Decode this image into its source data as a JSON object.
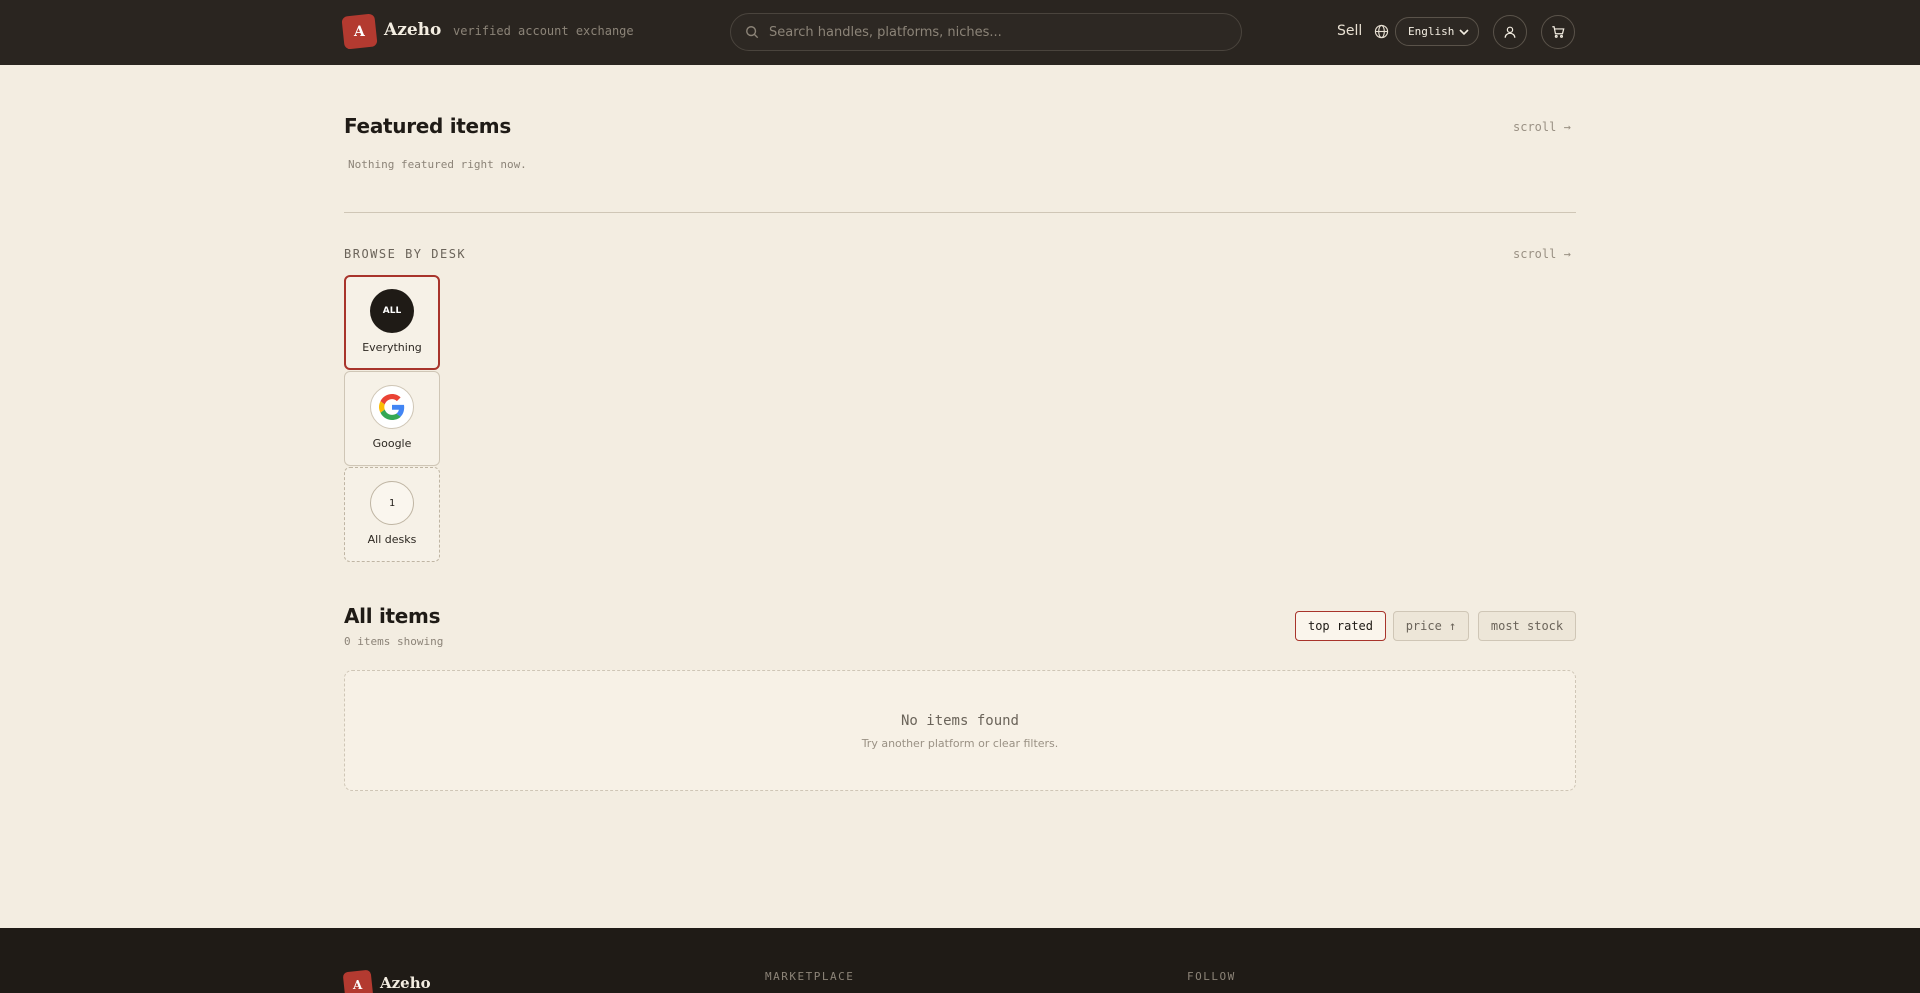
{
  "header": {
    "logo_letter": "A",
    "brand": "Azeho",
    "tagline": "verified account exchange",
    "search_placeholder": "Search handles, platforms, niches...",
    "sell_label": "Sell",
    "language": "English"
  },
  "featured": {
    "title": "Featured items",
    "scroll_label": "scroll →",
    "empty_text": "Nothing featured right now."
  },
  "browse": {
    "kicker": "BROWSE BY DESK",
    "scroll_label": "scroll →",
    "desks": [
      {
        "icon_text": "ALL",
        "label": "Everything"
      },
      {
        "icon": "google-icon",
        "label": "Google"
      },
      {
        "icon_text": "1",
        "label": "All desks"
      }
    ]
  },
  "items": {
    "title": "All items",
    "count_text": "0 items showing",
    "sort_options": [
      "top rated",
      "price ↑",
      "most stock"
    ],
    "empty_title": "No items found",
    "empty_sub": "Try another platform or clear filters."
  },
  "footer": {
    "logo_letter": "A",
    "brand": "Azeho",
    "col_marketplace": "MARKETPLACE",
    "col_follow": "FOLLOW"
  },
  "colors": {
    "accent": "#b33a30",
    "header_bg": "#2a2520",
    "page_bg": "#f3ede1"
  }
}
